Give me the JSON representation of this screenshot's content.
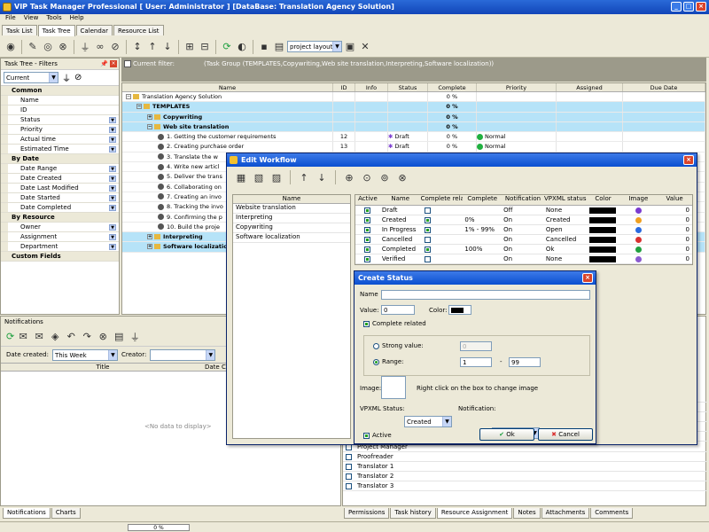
{
  "app": {
    "title": "VIP Task Manager Professional [ User: Administrator ] [DataBase: Translation Agency Solution]",
    "menu": [
      "File",
      "View",
      "Tools",
      "Help"
    ],
    "tabs": [
      "Task List",
      "Task Tree",
      "Calendar",
      "Resource List"
    ],
    "active_tab": "Task Tree",
    "layout_select": "project layout"
  },
  "filters": {
    "title": "Task Tree - Filters",
    "view_select": "Current",
    "rows": [
      {
        "label": "Common",
        "cat": true
      },
      {
        "label": "Name"
      },
      {
        "label": "ID"
      },
      {
        "label": "Status",
        "sel": true
      },
      {
        "label": "Priority",
        "sel": true
      },
      {
        "label": "Actual time",
        "sel": true
      },
      {
        "label": "Estimated Time",
        "sel": true
      },
      {
        "label": "By Date",
        "cat": true
      },
      {
        "label": "Date Range",
        "sel": true
      },
      {
        "label": "Date Created",
        "sel": true
      },
      {
        "label": "Date Last Modified",
        "sel": true
      },
      {
        "label": "Date Started",
        "sel": true
      },
      {
        "label": "Date Completed",
        "sel": true
      },
      {
        "label": "By Resource",
        "cat": true
      },
      {
        "label": "Owner",
        "sel": true
      },
      {
        "label": "Assignment",
        "sel": true
      },
      {
        "label": "Department",
        "sel": true
      },
      {
        "label": "Custom Fields",
        "cat": true
      }
    ]
  },
  "current_filter": {
    "label": "Current filter:",
    "value": "(Task Group  (TEMPLATES,Copywriting,Web site translation,Interpreting,Software localization))"
  },
  "tree": {
    "columns": [
      "Name",
      "ID",
      "Info",
      "Status",
      "Complete",
      "Priority",
      "Assigned",
      "Due Date"
    ],
    "rows": [
      {
        "name": "Translation Agency Solution",
        "id": "",
        "status": "",
        "complete": "0 %",
        "priority": "",
        "indent": 0,
        "hl": false,
        "bold": false
      },
      {
        "name": "TEMPLATES",
        "id": "",
        "status": "",
        "complete": "0 %",
        "priority": "",
        "indent": 1,
        "hl": true,
        "bold": true
      },
      {
        "name": "Copywriting",
        "id": "",
        "status": "",
        "complete": "0 %",
        "priority": "",
        "indent": 2,
        "hl": true,
        "bold": true
      },
      {
        "name": "Web site translation",
        "id": "",
        "status": "",
        "complete": "0 %",
        "priority": "",
        "indent": 2,
        "hl": true,
        "bold": true
      },
      {
        "name": "1. Getting the customer requirements",
        "id": "12",
        "status": "Draft",
        "complete": "0 %",
        "priority": "Normal",
        "indent": 3,
        "hl": false,
        "bold": false
      },
      {
        "name": "2. Creating purchase order",
        "id": "13",
        "status": "Draft",
        "complete": "0 %",
        "priority": "Normal",
        "indent": 3,
        "hl": false,
        "bold": false
      },
      {
        "name": "3. Translate the w",
        "id": "",
        "status": "",
        "complete": "",
        "priority": "",
        "indent": 3,
        "hl": false,
        "bold": false
      },
      {
        "name": "4. Write new articl",
        "id": "",
        "status": "",
        "complete": "",
        "priority": "",
        "indent": 3,
        "hl": false,
        "bold": false
      },
      {
        "name": "5. Deliver the trans",
        "id": "",
        "status": "",
        "complete": "",
        "priority": "",
        "indent": 3,
        "hl": false,
        "bold": false
      },
      {
        "name": "6. Collaborating on",
        "id": "",
        "status": "",
        "complete": "",
        "priority": "",
        "indent": 3,
        "hl": false,
        "bold": false
      },
      {
        "name": "7. Creating an invo",
        "id": "",
        "status": "",
        "complete": "",
        "priority": "",
        "indent": 3,
        "hl": false,
        "bold": false
      },
      {
        "name": "8. Tracking the invo",
        "id": "",
        "status": "",
        "complete": "",
        "priority": "",
        "indent": 3,
        "hl": false,
        "bold": false
      },
      {
        "name": "9. Confirming the p",
        "id": "",
        "status": "",
        "complete": "",
        "priority": "",
        "indent": 3,
        "hl": false,
        "bold": false
      },
      {
        "name": "10. Build the proje",
        "id": "",
        "status": "",
        "complete": "",
        "priority": "",
        "indent": 3,
        "hl": false,
        "bold": false
      },
      {
        "name": "Interpreting",
        "id": "",
        "status": "",
        "complete": "",
        "priority": "",
        "indent": 2,
        "hl": true,
        "bold": true
      },
      {
        "name": "Software localizatio",
        "id": "",
        "status": "",
        "complete": "",
        "priority": "",
        "indent": 2,
        "hl": true,
        "bold": true
      }
    ]
  },
  "notifications": {
    "title": "Notifications",
    "date_created_label": "Date created:",
    "date_created_value": "This Week",
    "creator_label": "Creator:",
    "creator_value": "",
    "columns": [
      "Title",
      "Date C"
    ],
    "empty": "<No data to display>",
    "tabs": [
      "Notifications",
      "Charts"
    ]
  },
  "resources": {
    "items": [
      "Project Manager",
      "Proofreader",
      "Translator 1",
      "Translator 2",
      "Translator 3"
    ],
    "tabs": [
      "Permissions",
      "Task history",
      "Resource Assignment",
      "Notes",
      "Attachments",
      "Comments"
    ]
  },
  "status_progress": "0 %",
  "edit_workflow": {
    "title": "Edit Workflow",
    "list_header": "Name",
    "list": [
      "Website translation",
      "Interpreting",
      "Copywriting",
      "Software localization"
    ],
    "columns": [
      "Active",
      "Name",
      "Complete related",
      "Complete",
      "Notification",
      "VPXML status",
      "Color",
      "Image",
      "Value"
    ],
    "rows": [
      {
        "active": true,
        "name": "Draft",
        "related": false,
        "complete": "",
        "notification": "Off",
        "vpxml": "None",
        "value": "0",
        "icon": "#7a3bd0"
      },
      {
        "active": true,
        "name": "Created",
        "related": true,
        "complete": "0%",
        "notification": "On",
        "vpxml": "Created",
        "value": "0",
        "icon": "#f0a020"
      },
      {
        "active": true,
        "name": "In Progress",
        "related": true,
        "complete": "1% - 99%",
        "notification": "On",
        "vpxml": "Open",
        "value": "0",
        "icon": "#2a6ae0"
      },
      {
        "active": true,
        "name": "Cancelled",
        "related": false,
        "complete": "",
        "notification": "On",
        "vpxml": "Cancelled",
        "value": "0",
        "icon": "#d93030"
      },
      {
        "active": true,
        "name": "Completed",
        "related": true,
        "complete": "100%",
        "notification": "On",
        "vpxml": "Ok",
        "value": "0",
        "icon": "#20a040"
      },
      {
        "active": true,
        "name": "Verified",
        "related": false,
        "complete": "",
        "notification": "On",
        "vpxml": "None",
        "value": "0",
        "icon": "#8a5ad0"
      }
    ]
  },
  "create_status": {
    "title": "Create Status",
    "name_label": "Name",
    "name_value": "",
    "value_label": "Value:",
    "value": "0",
    "color_label": "Color:",
    "complete_related_label": "Complete related",
    "strong_label": "Strong value:",
    "strong_value": "0",
    "range_label": "Range:",
    "range_from": "1",
    "range_sep": "-",
    "range_to": "99",
    "image_label": "Image:",
    "image_hint": "Right click on the box to  change image",
    "vpxml_label": "VPXML Status:",
    "vpxml_value": "Created",
    "notification_label": "Notification:",
    "notification_value": "On",
    "active_label": "Active",
    "ok_label": "Ok",
    "cancel_label": "Cancel"
  },
  "colors": {
    "highlight": "#b6e3f8",
    "title_blue": "#0a4fd0"
  }
}
